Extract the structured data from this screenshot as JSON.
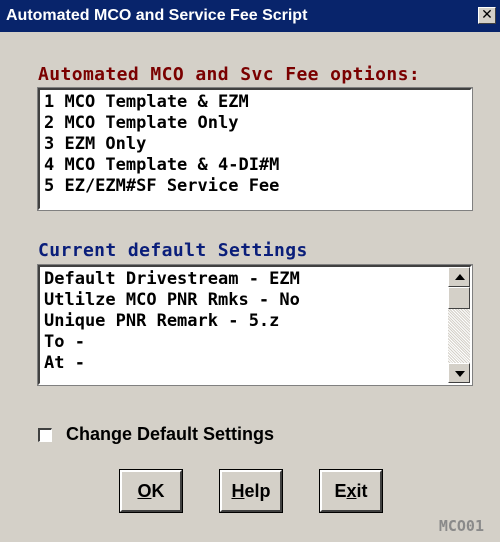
{
  "window": {
    "title": "Automated MCO and Service Fee Script",
    "close_label": "✕"
  },
  "options": {
    "heading": "Automated MCO and Svc Fee options:",
    "items": [
      "1 MCO Template & EZM",
      "2 MCO Template Only",
      "3 EZM Only",
      "4 MCO Template & 4-DI#M",
      "5 EZ/EZM#SF Service Fee"
    ]
  },
  "settings": {
    "heading": "Current default Settings",
    "items": [
      "Default Drivestream - EZM",
      "Utlilze MCO PNR Rmks - No",
      "Unique PNR Remark - 5.z",
      "To -",
      "At -"
    ]
  },
  "change_defaults": {
    "label": "Change Default Settings",
    "checked": false
  },
  "buttons": {
    "ok": {
      "mnemonic": "O",
      "rest": "K"
    },
    "help": {
      "mnemonic": "H",
      "rest": "elp"
    },
    "exit": {
      "pre": "E",
      "mnemonic": "x",
      "rest": "it"
    }
  },
  "screen_id": "MCO01",
  "colors": {
    "titlebar": "#08246b",
    "options_heading": "#7a0000",
    "settings_heading": "#0a1e7a",
    "dialog_bg": "#d4d0c8"
  }
}
